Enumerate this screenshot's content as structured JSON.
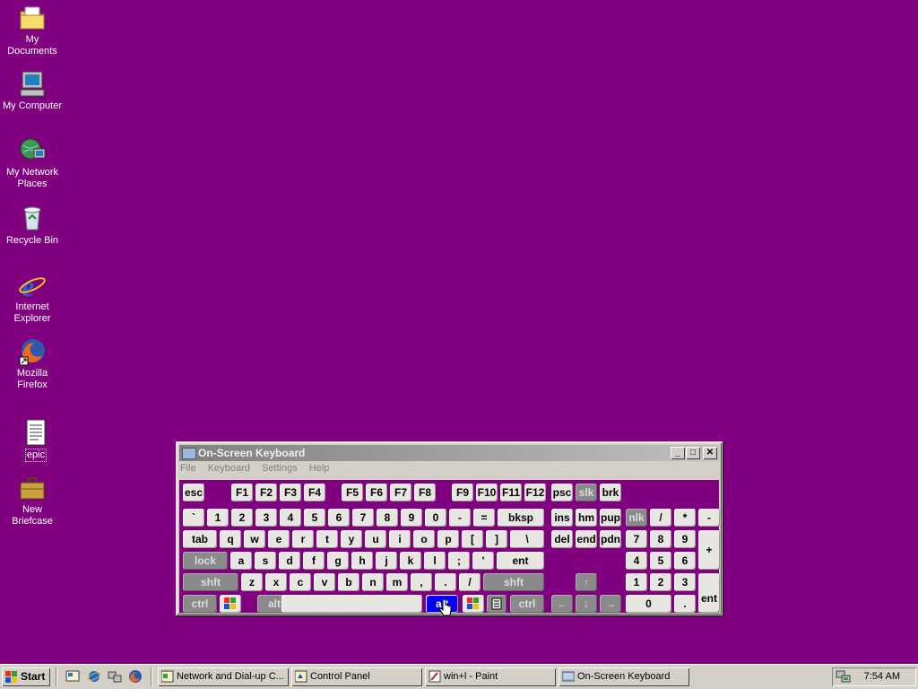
{
  "desktop": {
    "icons": [
      {
        "label": "My Documents"
      },
      {
        "label": "My Computer"
      },
      {
        "label": "My Network Places"
      },
      {
        "label": "Recycle Bin"
      },
      {
        "label": "Internet Explorer"
      },
      {
        "label": "Mozilla Firefox"
      },
      {
        "label": "epic"
      },
      {
        "label": "New Briefcase"
      }
    ]
  },
  "window": {
    "title": "On-Screen Keyboard",
    "controls": {
      "minimize": "_",
      "maximize": "□",
      "close": "✕"
    },
    "menu": [
      "File",
      "Keyboard",
      "Settings",
      "Help"
    ]
  },
  "keyboard": {
    "row0": [
      "esc",
      "F1",
      "F2",
      "F3",
      "F4",
      "F5",
      "F6",
      "F7",
      "F8",
      "F9",
      "F10",
      "F11",
      "F12",
      "psc",
      "slk",
      "brk"
    ],
    "row1": [
      "`",
      "1",
      "2",
      "3",
      "4",
      "5",
      "6",
      "7",
      "8",
      "9",
      "0",
      "-",
      "=",
      "bksp",
      "ins",
      "hm",
      "pup",
      "nlk",
      "/",
      "*",
      "-"
    ],
    "row2": [
      "tab",
      "q",
      "w",
      "e",
      "r",
      "t",
      "y",
      "u",
      "i",
      "o",
      "p",
      "[",
      "]",
      "\\",
      "del",
      "end",
      "pdn",
      "7",
      "8",
      "9",
      "+"
    ],
    "row3": [
      "lock",
      "a",
      "s",
      "d",
      "f",
      "g",
      "h",
      "j",
      "k",
      "l",
      ";",
      "'",
      "ent",
      "4",
      "5",
      "6"
    ],
    "row4": [
      "shft",
      "z",
      "x",
      "c",
      "v",
      "b",
      "n",
      "m",
      ",",
      ".",
      "/",
      "shft",
      "↑",
      "1",
      "2",
      "3",
      "ent"
    ],
    "row5": [
      "ctrl",
      "alt",
      "alt",
      "ctrl",
      "←",
      "↓",
      "→",
      "0",
      "."
    ]
  },
  "taskbar": {
    "start": "Start",
    "tasks": [
      "Network and Dial-up C...",
      "Control Panel",
      "win+l - Paint",
      "On-Screen Keyboard"
    ],
    "clock": "7:54 AM"
  },
  "colors": {
    "desktop": "#800080",
    "active_key": "#0000ff"
  }
}
